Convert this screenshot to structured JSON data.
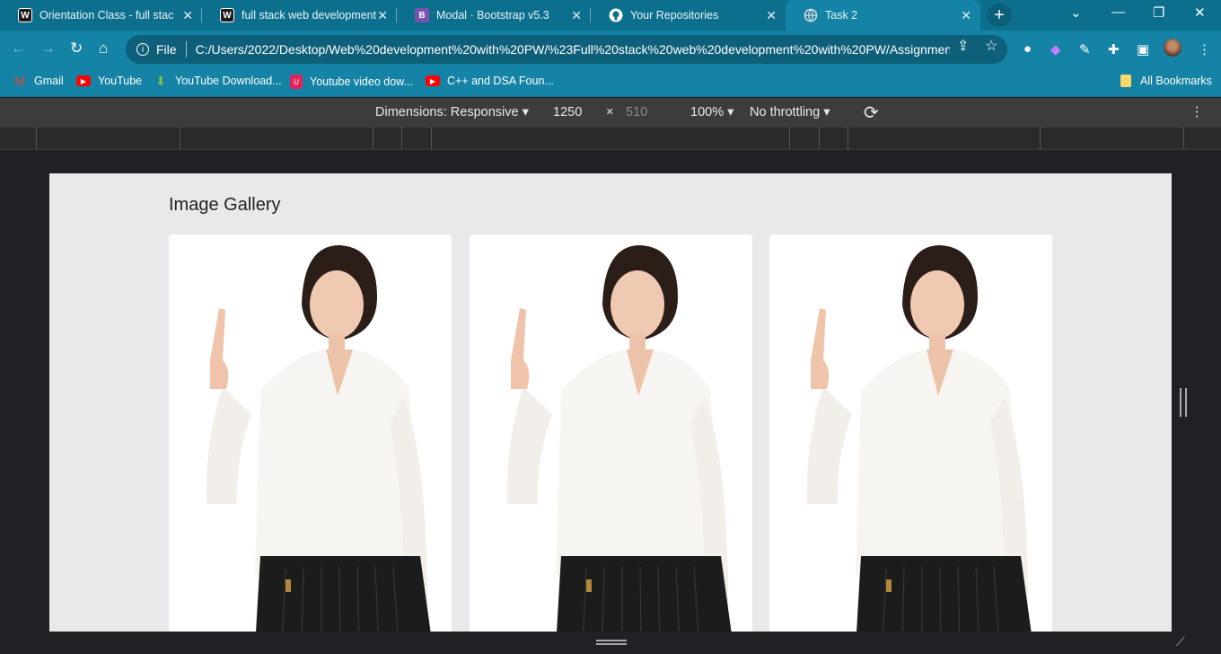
{
  "tabs": [
    {
      "title": "Orientation Class - full stack",
      "favicon": "W",
      "favicon_color": "#1e1e1e"
    },
    {
      "title": "full stack web development",
      "favicon": "W",
      "favicon_color": "#1e1e1e"
    },
    {
      "title": "Modal · Bootstrap v5.3",
      "favicon": "B",
      "favicon_color": "#7952b3"
    },
    {
      "title": "Your Repositories",
      "favicon": "github-icon",
      "favicon_color": "#ffffff"
    },
    {
      "title": "Task 2",
      "favicon": "globe-icon",
      "favicon_color": "#ffffff",
      "active": true
    }
  ],
  "omnibox": {
    "scheme_label": "File",
    "url": "C:/Users/2022/Desktop/Web%20development%20with%20PW/%23Full%20stack%20web%20development%20with%20PW/Assignmen..."
  },
  "bookmarks": [
    {
      "label": "Gmail",
      "icon": "gmail-icon"
    },
    {
      "label": "YouTube",
      "icon": "youtube-icon"
    },
    {
      "label": "YouTube Download...",
      "icon": "download-icon"
    },
    {
      "label": "Youtube video dow...",
      "icon": "u-icon"
    },
    {
      "label": "C++ and DSA Foun...",
      "icon": "youtube-icon"
    },
    {
      "label": "All Bookmarks",
      "icon": "folder-icon"
    }
  ],
  "device_toolbar": {
    "dimensions_label": "Dimensions: Responsive",
    "width": "1250",
    "times": "×",
    "height": "510",
    "zoom": "100%",
    "throttling": "No throttling"
  },
  "page": {
    "title": "Image Gallery",
    "gallery_count": 3
  },
  "colors": {
    "chrome_accent": "#1583a6",
    "tabstrip": "#0d6f8e",
    "page_bg": "#e9e9ec",
    "card_bg": "#ffffff"
  }
}
